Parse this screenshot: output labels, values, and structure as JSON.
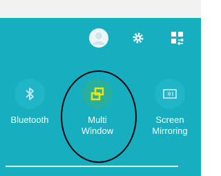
{
  "icons": {
    "avatar": "user-avatar-icon",
    "settings": "gear-icon",
    "panel": "grid-toggle-icon",
    "bluetooth": "bluetooth-icon",
    "multi_window": "multi-window-icon",
    "screen_mirroring": "screen-mirroring-icon"
  },
  "colors": {
    "panel_bg": "#18aec2",
    "tile_bg": "#20b5c8",
    "active_tile_bg": "#27b09f",
    "active_icon": "#f4e500",
    "label": "#ffffff",
    "highlight_ring": "#000000"
  },
  "quick_settings": [
    {
      "label": "Bluetooth",
      "active": false
    },
    {
      "label": "Multi\nWindow",
      "active": true
    },
    {
      "label": "Screen\nMirroring",
      "active": false
    }
  ]
}
